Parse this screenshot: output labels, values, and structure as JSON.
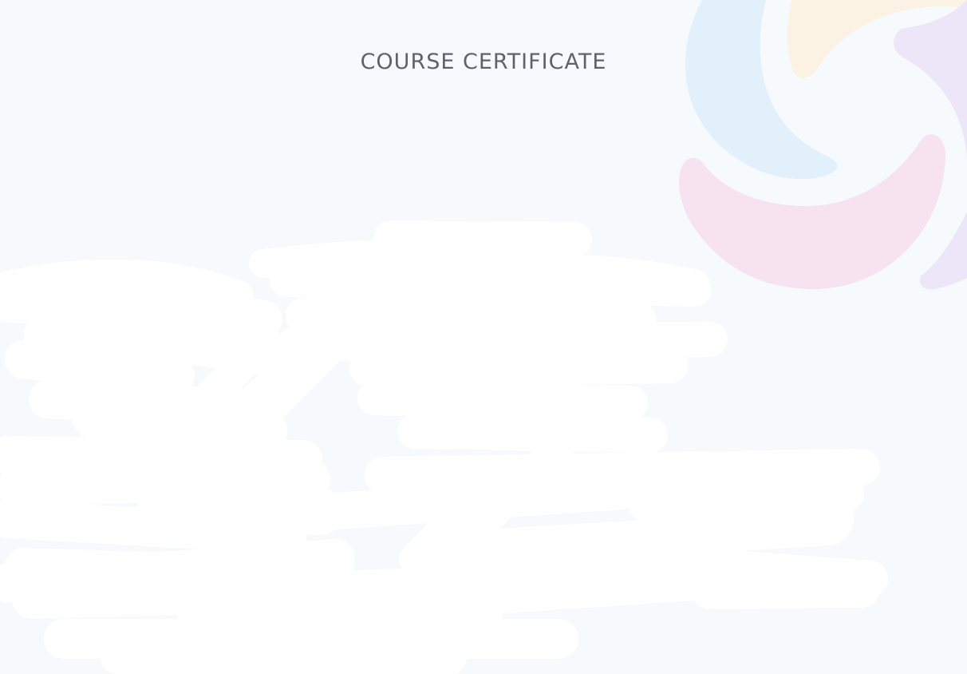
{
  "certificate": {
    "heading": "COURSE CERTIFICATE"
  },
  "decoration": {
    "logo_colors": {
      "blue": "#e1f0fb",
      "peach": "#fbf2e3",
      "lilac": "#ede6f8",
      "pink": "#f7e2ef"
    }
  },
  "redaction": {
    "color": "#ffffff"
  }
}
